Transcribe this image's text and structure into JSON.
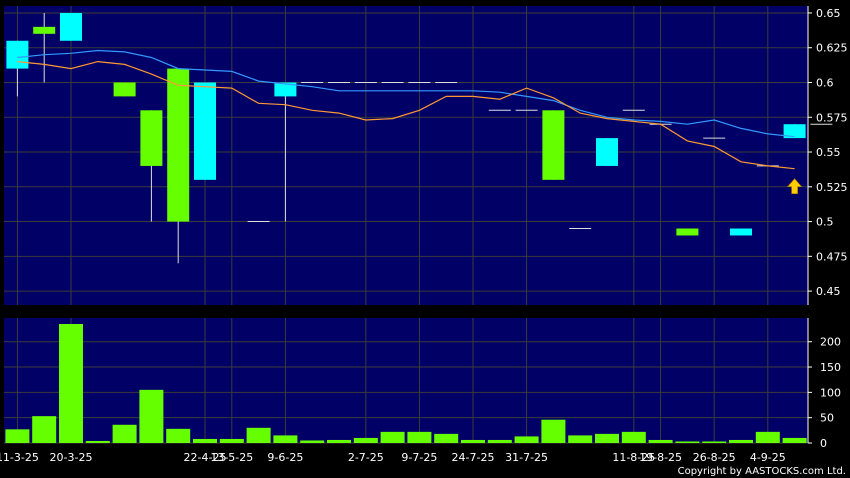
{
  "chart_data": [
    {
      "type": "candlestick",
      "colors": {
        "up": "#00ffff",
        "down": "#66ff00",
        "ma_fast": "#ff9933",
        "ma_slow": "#3399ff",
        "background": "#000066",
        "grid": "#3b3b3b"
      },
      "ylim": [
        0.44,
        0.655
      ],
      "y_ticks": [
        0.45,
        0.475,
        0.5,
        0.525,
        0.55,
        0.575,
        0.6,
        0.625,
        0.65
      ],
      "y_tick_labels": [
        "0.45",
        "0.475",
        "0.5",
        "0.525",
        "0.55",
        "0.575",
        "0.6",
        "0.625",
        "0.65"
      ],
      "candles": [
        {
          "open": 0.61,
          "high": 0.63,
          "low": 0.59,
          "close": 0.63
        },
        {
          "open": 0.64,
          "high": 0.65,
          "low": 0.6,
          "close": 0.635
        },
        {
          "open": 0.63,
          "high": 0.65,
          "low": 0.63,
          "close": 0.65
        },
        null,
        {
          "open": 0.6,
          "high": 0.6,
          "low": 0.59,
          "close": 0.59
        },
        {
          "open": 0.58,
          "high": 0.58,
          "low": 0.5,
          "close": 0.54
        },
        {
          "open": 0.61,
          "high": 0.61,
          "low": 0.47,
          "close": 0.5
        },
        {
          "open": 0.53,
          "high": 0.6,
          "low": 0.53,
          "close": 0.6
        },
        null,
        {
          "open": 0.5,
          "high": 0.5,
          "low": 0.5,
          "close": 0.5
        },
        {
          "open": 0.59,
          "high": 0.6,
          "low": 0.5,
          "close": 0.6
        },
        {
          "open": 0.6,
          "high": 0.6,
          "low": 0.6,
          "close": 0.6
        },
        {
          "open": 0.6,
          "high": 0.6,
          "low": 0.6,
          "close": 0.6
        },
        {
          "open": 0.6,
          "high": 0.6,
          "low": 0.6,
          "close": 0.6
        },
        {
          "open": 0.6,
          "high": 0.6,
          "low": 0.6,
          "close": 0.6
        },
        {
          "open": 0.6,
          "high": 0.6,
          "low": 0.6,
          "close": 0.6
        },
        {
          "open": 0.6,
          "high": 0.6,
          "low": 0.6,
          "close": 0.6
        },
        null,
        {
          "open": 0.58,
          "high": 0.58,
          "low": 0.58,
          "close": 0.58
        },
        {
          "open": 0.58,
          "high": 0.58,
          "low": 0.58,
          "close": 0.58
        },
        {
          "open": 0.58,
          "high": 0.58,
          "low": 0.53,
          "close": 0.53
        },
        {
          "open": 0.495,
          "high": 0.495,
          "low": 0.495,
          "close": 0.495
        },
        {
          "open": 0.54,
          "high": 0.56,
          "low": 0.54,
          "close": 0.56
        },
        {
          "open": 0.58,
          "high": 0.58,
          "low": 0.58,
          "close": 0.58
        },
        {
          "open": 0.57,
          "high": 0.57,
          "low": 0.57,
          "close": 0.57
        },
        {
          "open": 0.495,
          "high": 0.495,
          "low": 0.49,
          "close": 0.49
        },
        {
          "open": 0.56,
          "high": 0.56,
          "low": 0.56,
          "close": 0.56
        },
        {
          "open": 0.49,
          "high": 0.495,
          "low": 0.49,
          "close": 0.495
        },
        {
          "open": 0.54,
          "high": 0.54,
          "low": 0.54,
          "close": 0.54
        },
        {
          "open": 0.56,
          "high": 0.57,
          "low": 0.56,
          "close": 0.57
        },
        {
          "open": 0.57,
          "high": 0.57,
          "low": 0.57,
          "close": 0.57
        }
      ],
      "ma_fast": [
        0.615,
        0.613,
        0.61,
        0.615,
        0.613,
        0.606,
        0.598,
        0.597,
        0.596,
        0.585,
        0.584,
        0.58,
        0.578,
        0.573,
        0.574,
        0.58,
        0.59,
        0.59,
        0.588,
        0.596,
        0.589,
        0.578,
        0.574,
        0.572,
        0.57,
        0.558,
        0.554,
        0.543,
        0.54,
        0.538
      ],
      "ma_slow": [
        0.618,
        0.62,
        0.621,
        0.623,
        0.622,
        0.618,
        0.61,
        0.609,
        0.608,
        0.601,
        0.599,
        0.597,
        0.594,
        0.594,
        0.594,
        0.594,
        0.594,
        0.594,
        0.593,
        0.59,
        0.587,
        0.58,
        0.575,
        0.573,
        0.572,
        0.57,
        0.573,
        0.567,
        0.563,
        0.561
      ],
      "volume": {
        "ylim": [
          0,
          235
        ],
        "y_ticks": [
          0,
          50,
          100,
          150,
          200
        ],
        "y_tick_labels": [
          "0",
          "50",
          "100",
          "150",
          "200"
        ],
        "values": [
          27,
          53,
          235,
          4,
          36,
          105,
          28,
          8,
          8,
          30,
          15,
          5,
          6,
          10,
          22,
          22,
          18,
          6,
          6,
          13,
          46,
          15,
          18,
          22,
          6,
          3,
          3,
          6,
          22,
          10
        ]
      },
      "x_tick_labels": [
        {
          "index": 0,
          "label": "11-3-25"
        },
        {
          "index": 2,
          "label": "20-3-25"
        },
        {
          "index": 7,
          "label": "22-4-25"
        },
        {
          "index": 8,
          "label": "13-5-25"
        },
        {
          "index": 10,
          "label": "9-6-25"
        },
        {
          "index": 13,
          "label": "2-7-25"
        },
        {
          "index": 15,
          "label": "9-7-25"
        },
        {
          "index": 17,
          "label": "24-7-25"
        },
        {
          "index": 19,
          "label": "31-7-25"
        },
        {
          "index": 23,
          "label": "11-8-25"
        },
        {
          "index": 24,
          "label": "19-8-25"
        },
        {
          "index": 26,
          "label": "26-8-25"
        },
        {
          "index": 28,
          "label": "4-9-25"
        }
      ],
      "annotation": {
        "index": 29,
        "icon": "up-arrow-icon",
        "color": "#ffcc00"
      }
    }
  ],
  "footer": {
    "copyright": "Copyright by AASTOCKS.com Ltd."
  }
}
